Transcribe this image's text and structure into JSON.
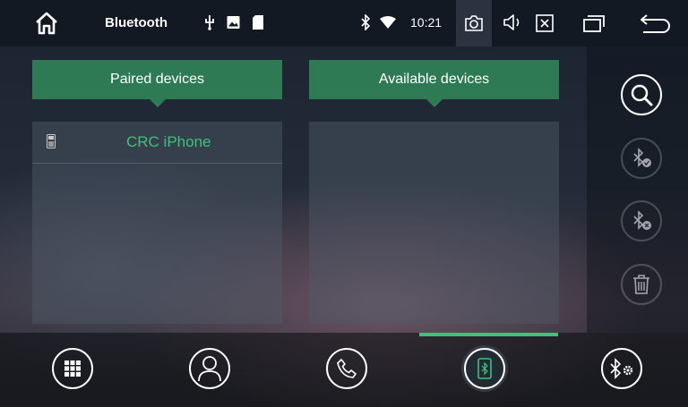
{
  "statusbar": {
    "title": "Bluetooth",
    "time": "10:21",
    "icons": [
      "home-icon",
      "usb-icon",
      "image-icon",
      "sd-card-icon",
      "bluetooth-icon",
      "wifi-icon",
      "camera-icon",
      "volume-icon",
      "close-window-icon",
      "recent-apps-icon",
      "back-icon"
    ]
  },
  "panels": {
    "paired": {
      "header": "Paired devices",
      "devices": [
        {
          "name": "CRC iPhone",
          "icon": "phone-icon"
        }
      ]
    },
    "available": {
      "header": "Available devices",
      "devices": []
    }
  },
  "sidebar": {
    "buttons": [
      {
        "icon": "search-icon",
        "enabled": true
      },
      {
        "icon": "bluetooth-connect-icon",
        "enabled": false
      },
      {
        "icon": "bluetooth-disconnect-icon",
        "enabled": false
      },
      {
        "icon": "trash-icon",
        "enabled": false
      }
    ]
  },
  "bottom_nav": {
    "items": [
      {
        "icon": "dialpad-icon"
      },
      {
        "icon": "contacts-icon"
      },
      {
        "icon": "call-icon"
      },
      {
        "icon": "bluetooth-phone-icon",
        "active": true
      },
      {
        "icon": "bluetooth-settings-icon"
      }
    ]
  },
  "colors": {
    "accent": "#3ec27a",
    "header_green": "#2e7a55"
  }
}
